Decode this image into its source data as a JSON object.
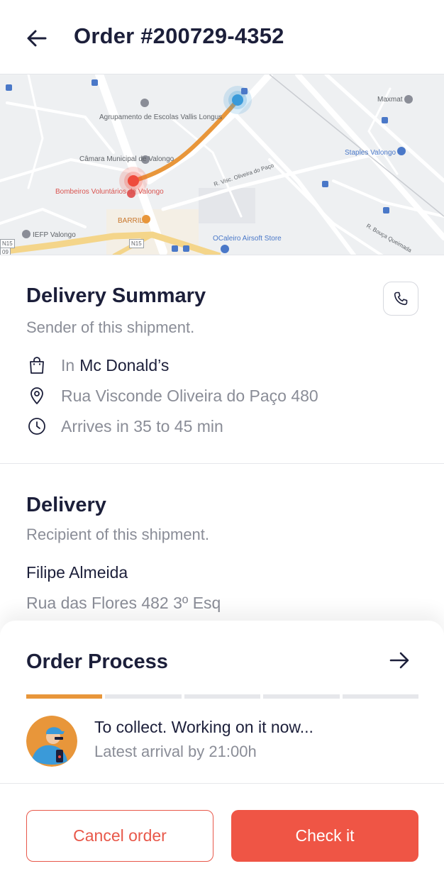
{
  "header": {
    "title": "Order #200729-4352",
    "back_icon": "arrow-left-icon"
  },
  "map": {
    "labels": {
      "agrupamento": "Agrupamento de Escolas Vallis Longus",
      "camara": "Câmara Municipal de Valongo",
      "bombeiros": "Bombeiros Voluntários de Valongo",
      "barril": "BARRIL",
      "iefp": "IEFP Valongo",
      "ocaleiro": "OCaleiro Airsoft Store",
      "maxmat": "Maxmat",
      "staples": "Staples Valongo",
      "rua_visc": "R. Visc. Oliveira do Paço",
      "rua_bouca": "R. Bouça Queimada",
      "n15": "N15",
      "n15b": "N15",
      "r09": "09"
    },
    "colors": {
      "route": "#e8963a",
      "origin": "#ef4b3c",
      "destination": "#3a9ad9"
    }
  },
  "delivery_summary": {
    "title": "Delivery Summary",
    "subtitle": "Sender of this shipment.",
    "store_prefix": "In",
    "store_name": "Mc Donald’s",
    "address": "Rua Visconde Oliveira do Paço 480",
    "eta": "Arrives in 35 to 45 min",
    "icons": [
      "shopping-bag-icon",
      "location-pin-icon",
      "clock-icon",
      "phone-icon"
    ]
  },
  "delivery": {
    "title": "Delivery",
    "subtitle": "Recipient of this shipment.",
    "name": "Filipe Almeida",
    "address": "Rua das Flores 482 3º Esq"
  },
  "order_process": {
    "title": "Order Process",
    "progress_segments": 5,
    "active_segments": 1,
    "status": "To collect. Working on it now...",
    "latest_arrival": "Latest arrival by 21:00h",
    "accent_color": "#e8963a"
  },
  "actions": {
    "cancel_label": "Cancel order",
    "check_label": "Check it"
  }
}
